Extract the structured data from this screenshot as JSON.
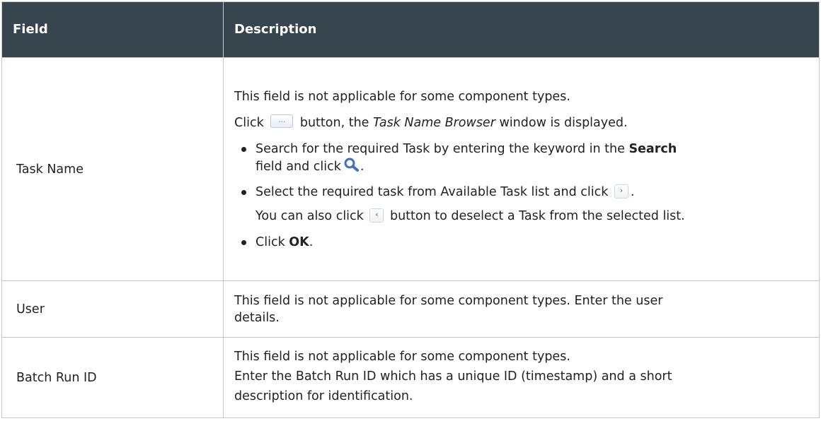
{
  "table": {
    "headers": {
      "field": "Field",
      "description": "Description"
    },
    "rows": [
      {
        "field": "Task Name",
        "intro": "This field is not applicable for some component types.",
        "click_prefix": "Click",
        "click_middle": "button, the",
        "browser_name": "Task Name Browser",
        "click_suffix": "window is displayed.",
        "bullet1_part1": "Search for the required Task by entering the keyword in the",
        "bullet1_bold": "Search",
        "bullet1_part2": "field and click",
        "bullet1_end": ".",
        "bullet2_text": "Select the required task from Available Task list and click",
        "bullet2_end": ".",
        "note_prefix": "You can also click",
        "note_suffix": "button to deselect a Task from the selected list.",
        "bullet3_prefix": "Click",
        "bullet3_bold": "OK",
        "bullet3_end": ".",
        "ellipsis_glyph": "...",
        "next_glyph": "›",
        "prev_glyph": "‹"
      },
      {
        "field": "User",
        "line1": "This field is not applicable for some component types. Enter the user",
        "line2": "details."
      },
      {
        "field": "Batch Run ID",
        "line1": "This field is not applicable for some component types.",
        "line2": "Enter the Batch Run ID which has a unique ID (timestamp) and a short",
        "line3": "description for identification."
      }
    ]
  },
  "icons": {
    "ellipsis_button": "browse-ellipsis-icon",
    "search": "search-icon",
    "move_right": "chevron-right-icon",
    "move_left": "chevron-left-icon"
  },
  "colors": {
    "header_bg": "#37454f",
    "header_text": "#ffffff",
    "border": "#c8c8c8",
    "search_icon": "#3d73b8"
  }
}
